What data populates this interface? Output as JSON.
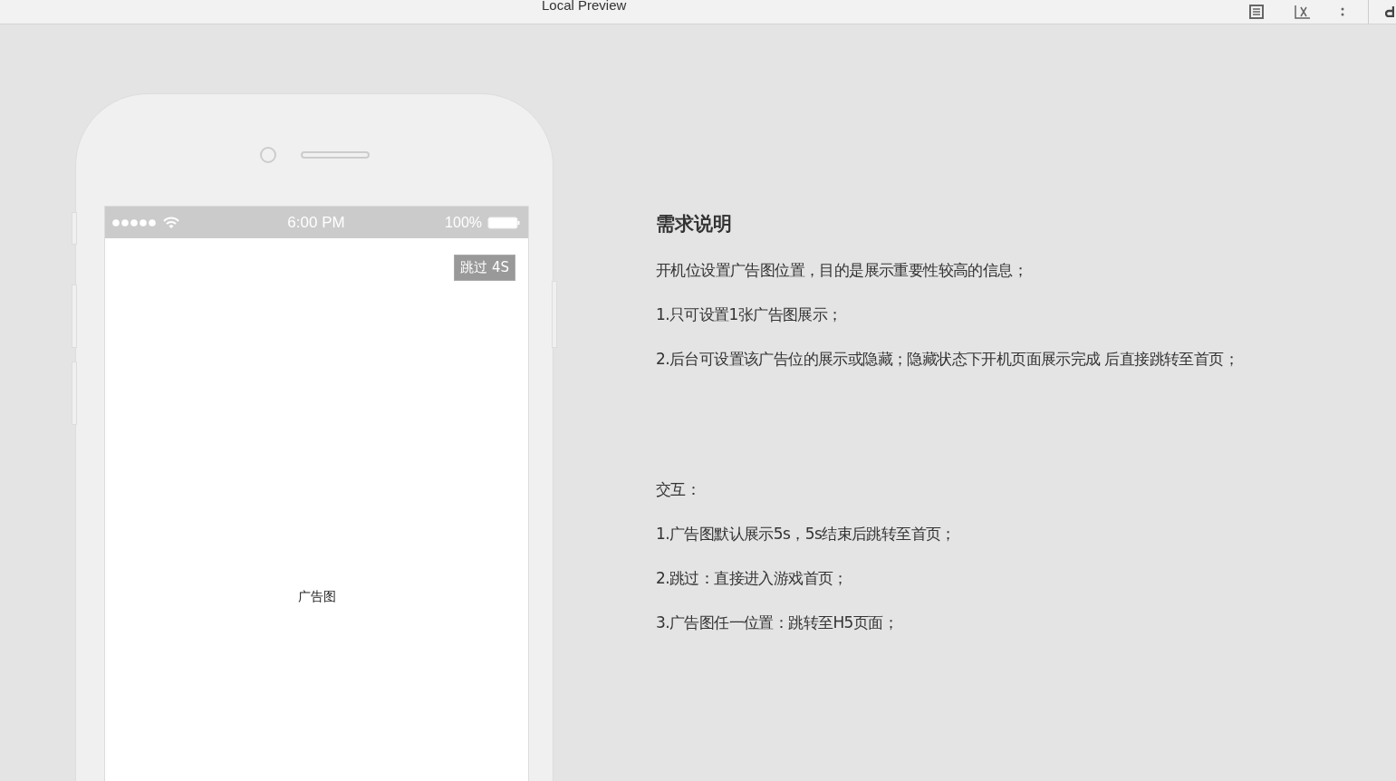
{
  "window": {
    "title": "Local Preview"
  },
  "phone": {
    "status_bar": {
      "time": "6:00 PM",
      "battery": "100%"
    },
    "skip_button": "跳过 4S",
    "ad_label": "广告图"
  },
  "requirements": {
    "title": "需求说明",
    "lines": [
      "开机位设置广告图位置，目的是展示重要性较高的信息；",
      "1.只可设置1张广告图展示；",
      "2.后台可设置该广告位的展示或隐藏；隐藏状态下开机页面展示完成 后直接跳转至首页；"
    ]
  },
  "interaction": {
    "title": "交互：",
    "lines": [
      "1.广告图默认展示5s，5s结束后跳转至首页；",
      "2.跳过：直接进入游戏首页；",
      "3.广告图任一位置：跳转至H5页面；"
    ]
  }
}
